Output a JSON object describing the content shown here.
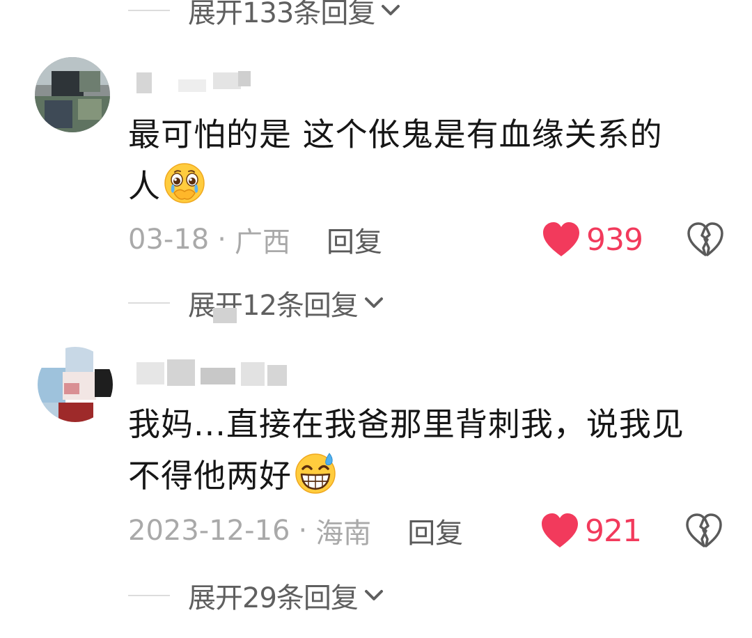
{
  "colors": {
    "like_red": "#f23a5c",
    "meta_gray": "#a9a9a9",
    "text_dark": "#161616"
  },
  "top_expand": {
    "label": "展开133条回复"
  },
  "comments": [
    {
      "text_lines": [
        "最可怕的是 这个伥鬼是有血缘关系的",
        "人"
      ],
      "emoji": "crying-pleading-emoji",
      "date": "03-18",
      "separator": "·",
      "location": "广西",
      "reply_label": "回复",
      "likes": "939",
      "expand_label": "展开12条回复"
    },
    {
      "text_lines": [
        "我妈...直接在我爸那里背刺我，说我见",
        "不得他两好"
      ],
      "emoji": "sweat-grin-emoji",
      "date": "2023-12-16",
      "separator": "·",
      "location": "海南",
      "reply_label": "回复",
      "likes": "921",
      "expand_label": "展开29条回复"
    }
  ]
}
